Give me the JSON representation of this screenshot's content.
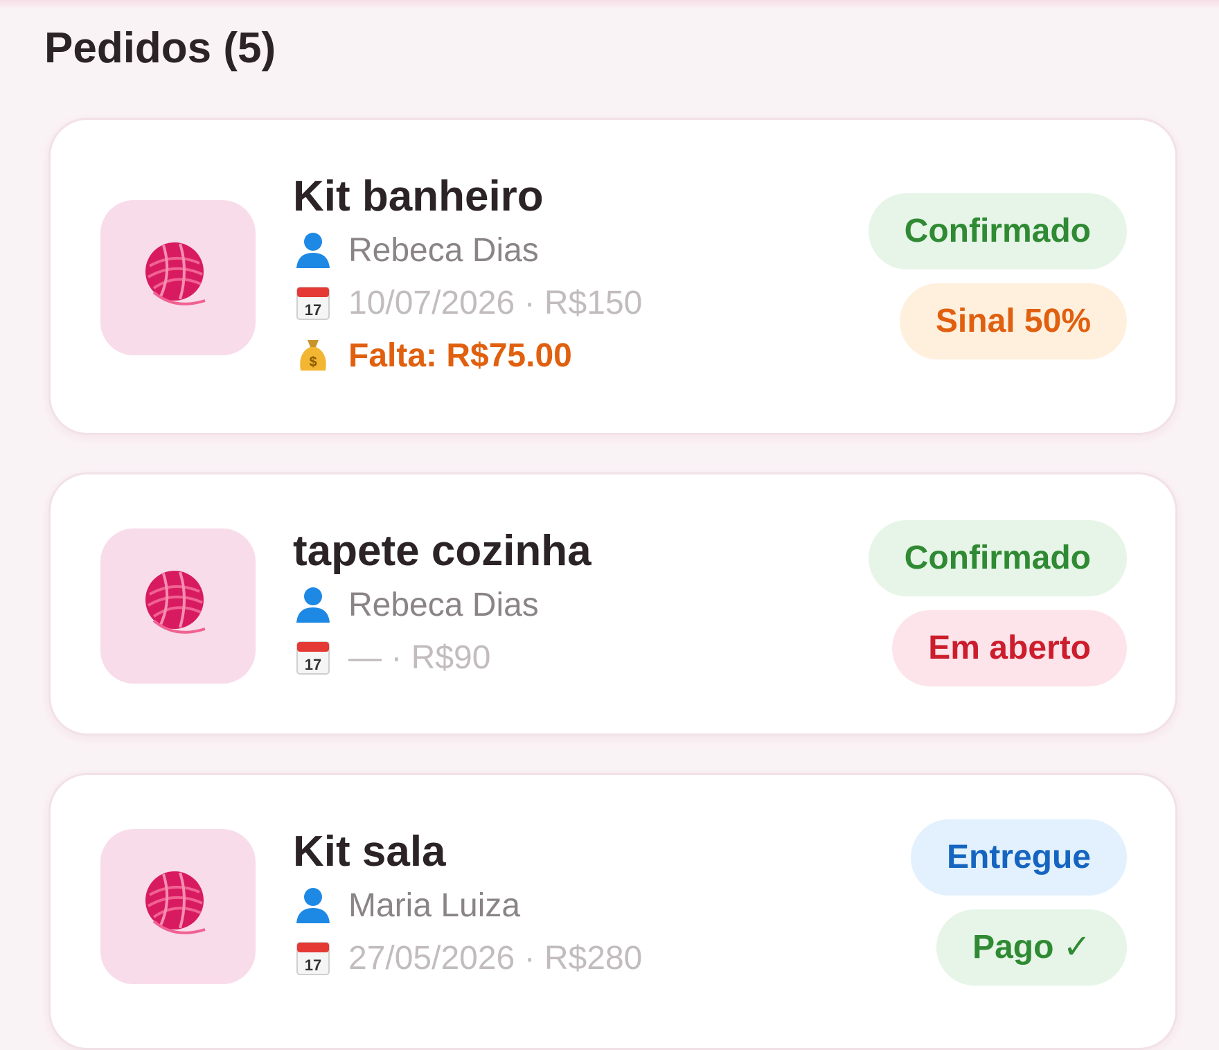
{
  "header": {
    "title": "Pedidos (5)"
  },
  "orders": [
    {
      "title": "Kit banheiro",
      "client": "Rebeca Dias",
      "meta": "10/07/2026 · R$150",
      "due": "Falta: R$75.00",
      "status": "Confirmado",
      "payment": "Sinal 50%"
    },
    {
      "title": "tapete cozinha",
      "client": "Rebeca Dias",
      "meta": "— · R$90",
      "status": "Confirmado",
      "payment": "Em aberto"
    },
    {
      "title": "Kit sala",
      "client": "Maria Luiza",
      "meta": "27/05/2026 · R$280",
      "status": "Entregue",
      "payment": "Pago ✓"
    }
  ],
  "icons": {
    "thumbnail": "yarn-ball-icon",
    "client": "person-icon",
    "date": "calendar-icon",
    "due": "money-bag-icon"
  },
  "colors": {
    "background": "#faf3f6",
    "thumb_bg": "#f8dcea",
    "yarn": "#d81b60",
    "due": "#e0600f",
    "green_badge_text": "#2f8a33",
    "blue_badge_text": "#1565c0",
    "red_badge_text": "#cc1d2c"
  }
}
